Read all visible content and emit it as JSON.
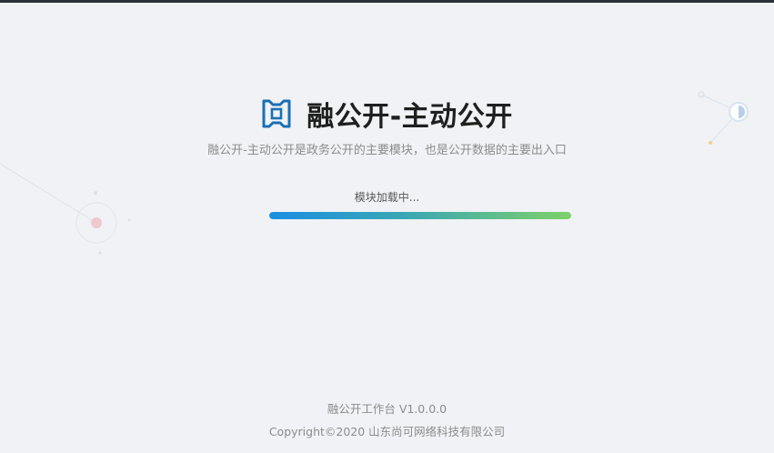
{
  "app": {
    "title": "融公开-主动公开",
    "subtitle": "融公开-主动公开是政务公开的主要模块，也是公开数据的主要出入口",
    "logo_icon": "bracket-square-logo-icon"
  },
  "loading": {
    "text": "模块加载中...",
    "progress_fraction": 1.0
  },
  "footer": {
    "version": "融公开工作台 V1.0.0.0",
    "copyright": "Copyright©2020 山东尚可网络科技有限公司"
  },
  "colors": {
    "background": "#f0f2f5",
    "brand_blue": "#1a6fb5",
    "progress_start": "#1a8fe3",
    "progress_end": "#7ed06a",
    "top_bar": "#2b2f36"
  }
}
